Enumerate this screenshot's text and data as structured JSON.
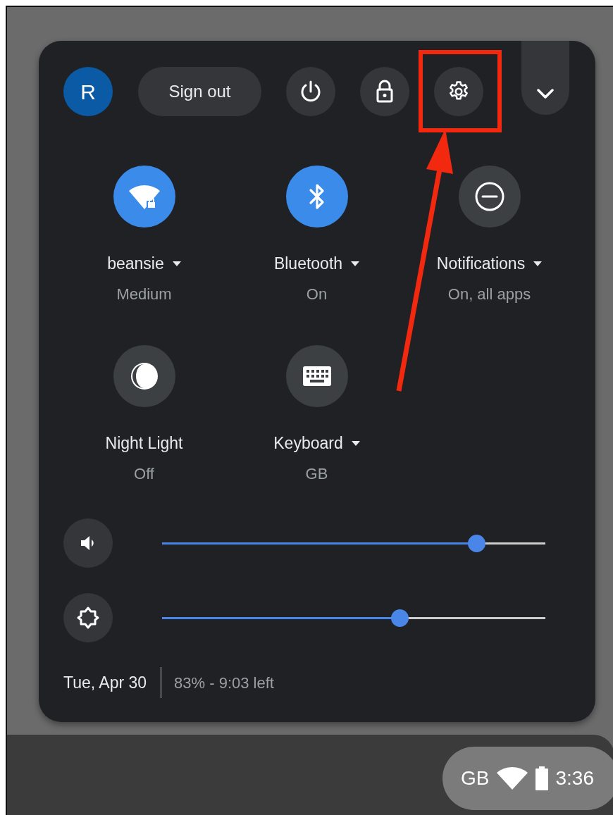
{
  "top_bar": {
    "avatar_initial": "R",
    "sign_out": "Sign out",
    "buttons": [
      {
        "kind": "power"
      },
      {
        "kind": "lock"
      },
      {
        "kind": "settings"
      }
    ]
  },
  "tiles": [
    {
      "kind": "wifi",
      "label": "beansie",
      "sublabel": "Medium",
      "on": true,
      "menu": true
    },
    {
      "kind": "bluetooth",
      "label": "Bluetooth",
      "sublabel": "On",
      "on": true,
      "menu": true
    },
    {
      "kind": "notifications",
      "label": "Notifications",
      "sublabel": "On, all apps",
      "on": false,
      "menu": true
    },
    {
      "kind": "night_light",
      "label": "Night Light",
      "sublabel": "Off",
      "on": false,
      "menu": false
    },
    {
      "kind": "keyboard",
      "label": "Keyboard",
      "sublabel": "GB",
      "on": false,
      "menu": true
    }
  ],
  "sliders": [
    {
      "kind": "volume",
      "level": 0.82
    },
    {
      "kind": "brightness",
      "level": 0.62
    }
  ],
  "footer": {
    "date": "Tue, Apr 30",
    "battery": "83% - 9:03 left"
  },
  "shelf": {
    "keyboard_layout": "GB",
    "time": "3:36"
  }
}
